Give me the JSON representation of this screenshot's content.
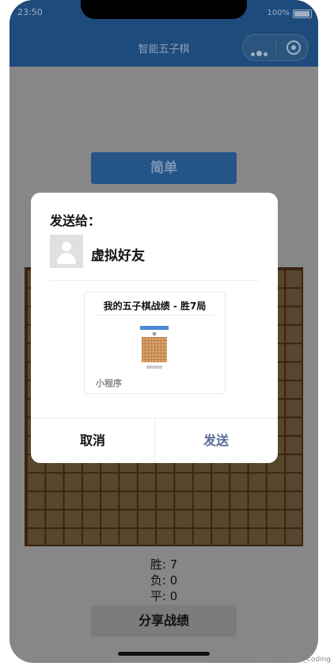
{
  "status_bar": {
    "time": "23:50",
    "battery": "100%"
  },
  "navbar": {
    "title": "智能五子棋"
  },
  "game": {
    "level_label": "简单",
    "stats": {
      "win": "胜: 7",
      "lose": "负: 0",
      "draw": "平: 0"
    },
    "share_label": "分享战绩"
  },
  "share_dialog": {
    "send_to_label": "发送给：",
    "friend_name": "虚拟好友",
    "card_title": "我的五子棋战绩 - 胜7局",
    "card_footer": "小程序",
    "cancel_label": "取消",
    "send_label": "发送"
  },
  "watermark": "CSDN @silence_coding",
  "colors": {
    "navbar": "#1d4b7c",
    "board": "#57472f",
    "send": "#576b95"
  }
}
